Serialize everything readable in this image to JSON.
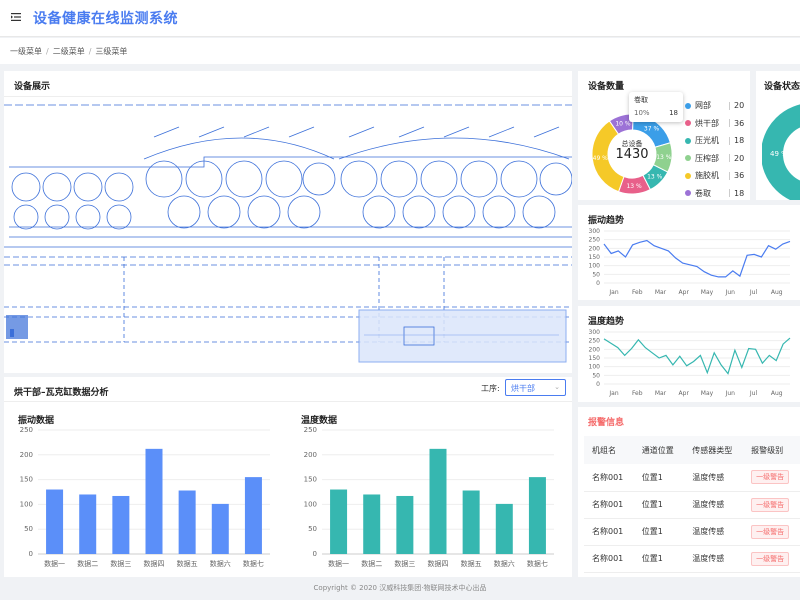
{
  "app": {
    "title": "设备健康在线监测系统"
  },
  "breadcrumb": [
    "一级菜单",
    "二级菜单",
    "三级菜单"
  ],
  "cards": {
    "display": "设备展示",
    "count": "设备数量",
    "status": "设备状态",
    "vibration_trend": "振动趋势",
    "temp_trend": "温度趋势",
    "analysis": "烘干部–瓦克缸数据分析",
    "alarm": "报警信息"
  },
  "analysis": {
    "process_label": "工序:",
    "process_value": "烘干部",
    "vibration_title": "振动数据",
    "temperature_title": "温度数据"
  },
  "donut": {
    "center_label": "总设备",
    "center_value": "1430",
    "slices": [
      {
        "name": "网部",
        "value": 20,
        "pct": "37 %",
        "color": "#3b9ee8"
      },
      {
        "name": "烘干部",
        "value": 36,
        "pct": "13 %",
        "color": "#e8608a"
      },
      {
        "name": "压光机",
        "value": 18,
        "pct": "13 %",
        "color": "#36b7b0"
      },
      {
        "name": "压榨部",
        "value": 20,
        "pct": "13 %",
        "color": "#8fd18f"
      },
      {
        "name": "施胶机",
        "value": 36,
        "pct": "49 %",
        "color": "#f5c928"
      },
      {
        "name": "卷取",
        "value": 18,
        "pct": "10 %",
        "color": "#9c72d6"
      }
    ],
    "tooltip": {
      "name": "卷取",
      "pct": "10%",
      "value": "18"
    }
  },
  "status_donut": {
    "pct": "49 %"
  },
  "alarm_table": {
    "headers": [
      "机组名",
      "通道位置",
      "传感器类型",
      "报警级别"
    ],
    "rows": [
      [
        "名称001",
        "位置1",
        "温度传感",
        "一级警告"
      ],
      [
        "名称001",
        "位置1",
        "温度传感",
        "一级警告"
      ],
      [
        "名称001",
        "位置1",
        "温度传感",
        "一级警告"
      ],
      [
        "名称001",
        "位置1",
        "温度传感",
        "一级警告"
      ]
    ]
  },
  "footer": "Copyright © 2020 汉威科技集团·物联网技术中心出品",
  "colors": {
    "accent": "#4a7cf0",
    "teal": "#36b7b0",
    "alarm": "#f56c6c"
  },
  "chart_data": [
    {
      "type": "line",
      "title": "振动趋势",
      "categories": [
        "Jan",
        "Feb",
        "Mar",
        "Apr",
        "May",
        "Jun",
        "Jul",
        "Aug"
      ],
      "series": [
        {
          "values": [
            225,
            170,
            185,
            150,
            220,
            235,
            245,
            215,
            200,
            185,
            145,
            115,
            105,
            95,
            65,
            45,
            35,
            35,
            70,
            40,
            160,
            165,
            150,
            215,
            195,
            225,
            240
          ]
        }
      ],
      "ylim": [
        0,
        300
      ],
      "yticks": [
        0,
        50,
        100,
        150,
        200,
        250,
        300
      ],
      "color": "#4a7cf0"
    },
    {
      "type": "line",
      "title": "温度趋势",
      "categories": [
        "Jan",
        "Feb",
        "Mar",
        "Apr",
        "May",
        "Jun",
        "Jul",
        "Aug"
      ],
      "series": [
        {
          "values": [
            260,
            235,
            210,
            165,
            205,
            255,
            210,
            180,
            150,
            165,
            110,
            160,
            105,
            130,
            165,
            65,
            180,
            110,
            60,
            195,
            95,
            205,
            200,
            120,
            165,
            135,
            230,
            265
          ]
        }
      ],
      "ylim": [
        0,
        300
      ],
      "yticks": [
        0,
        50,
        100,
        150,
        200,
        250,
        300
      ],
      "color": "#36b7b0"
    },
    {
      "type": "bar",
      "title": "振动数据",
      "categories": [
        "数据一",
        "数据二",
        "数据三",
        "数据四",
        "数据五",
        "数据六",
        "数据七"
      ],
      "values": [
        130,
        120,
        117,
        212,
        128,
        101,
        155
      ],
      "ylim": [
        0,
        250
      ],
      "yticks": [
        0,
        50,
        100,
        150,
        200,
        250
      ],
      "color": "#5b8ff9"
    },
    {
      "type": "bar",
      "title": "温度数据",
      "categories": [
        "数据一",
        "数据二",
        "数据三",
        "数据四",
        "数据五",
        "数据六",
        "数据七"
      ],
      "values": [
        130,
        120,
        117,
        212,
        128,
        101,
        155
      ],
      "ylim": [
        0,
        250
      ],
      "yticks": [
        0,
        50,
        100,
        150,
        200,
        250
      ],
      "color": "#36b7b0"
    }
  ]
}
